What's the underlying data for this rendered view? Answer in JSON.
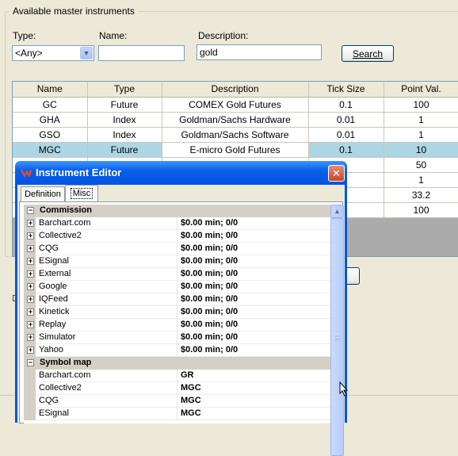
{
  "group_title": "Available master instruments",
  "filters": {
    "type_label": "Type:",
    "type_value": "<Any>",
    "name_label": "Name:",
    "name_value": "",
    "description_label": "Description:",
    "description_value": "gold",
    "search_button": "Search"
  },
  "grid": {
    "columns": [
      "Name",
      "Type",
      "Description",
      "Tick Size",
      "Point Val."
    ],
    "rows": [
      {
        "name": "GC",
        "type": "Future",
        "description": "COMEX Gold Futures",
        "tick": "0.1",
        "point": "100"
      },
      {
        "name": "GHA",
        "type": "Index",
        "description": "Goldman/Sachs Hardware",
        "tick": "0.01",
        "point": "1"
      },
      {
        "name": "GSO",
        "type": "Index",
        "description": "Goldman/Sachs Software",
        "tick": "0.01",
        "point": "1"
      },
      {
        "name": "MGC",
        "type": "Future",
        "description": "E-micro Gold Futures",
        "tick": "0.1",
        "point": "10"
      },
      {
        "name": "",
        "type": "",
        "description": "",
        "tick": "25",
        "point": "50"
      },
      {
        "name": "",
        "type": "",
        "description": "",
        "tick": "01",
        "point": "1"
      },
      {
        "name": "",
        "type": "",
        "description": "",
        "tick": "1",
        "point": "33.2"
      },
      {
        "name": "",
        "type": "",
        "description": "",
        "tick": "1",
        "point": "100"
      }
    ],
    "selected_row": 3
  },
  "dialog": {
    "title": "Instrument Editor",
    "tabs": [
      "Definition",
      "Misc"
    ],
    "active_tab": "Misc",
    "commission_header": "Commission",
    "commission_items": [
      {
        "name": "Barchart.com",
        "value": "$0.00 min;  0/0"
      },
      {
        "name": "Collective2",
        "value": "$0.00 min;  0/0"
      },
      {
        "name": "CQG",
        "value": "$0.00 min;  0/0"
      },
      {
        "name": "ESignal",
        "value": "$0.00 min;  0/0"
      },
      {
        "name": "External",
        "value": "$0.00 min;  0/0"
      },
      {
        "name": "Google",
        "value": "$0.00 min;  0/0"
      },
      {
        "name": "IQFeed",
        "value": "$0.00 min;  0/0"
      },
      {
        "name": "Kinetick",
        "value": "$0.00 min;  0/0"
      },
      {
        "name": "Replay",
        "value": "$0.00 min;  0/0"
      },
      {
        "name": "Simulator",
        "value": "$0.00 min;  0/0"
      },
      {
        "name": "Yahoo",
        "value": "$0.00 min;  0/0"
      }
    ],
    "symbol_map_header": "Symbol map",
    "symbol_map_items": [
      {
        "name": "Barchart.com",
        "value": "GR"
      },
      {
        "name": "Collective2",
        "value": "MGC"
      },
      {
        "name": "CQG",
        "value": "MGC"
      },
      {
        "name": "ESignal",
        "value": "MGC"
      }
    ]
  },
  "colors": {
    "selected_row": "#add6e4",
    "titlebar": "#0054e3",
    "close_button": "#cc4426"
  }
}
